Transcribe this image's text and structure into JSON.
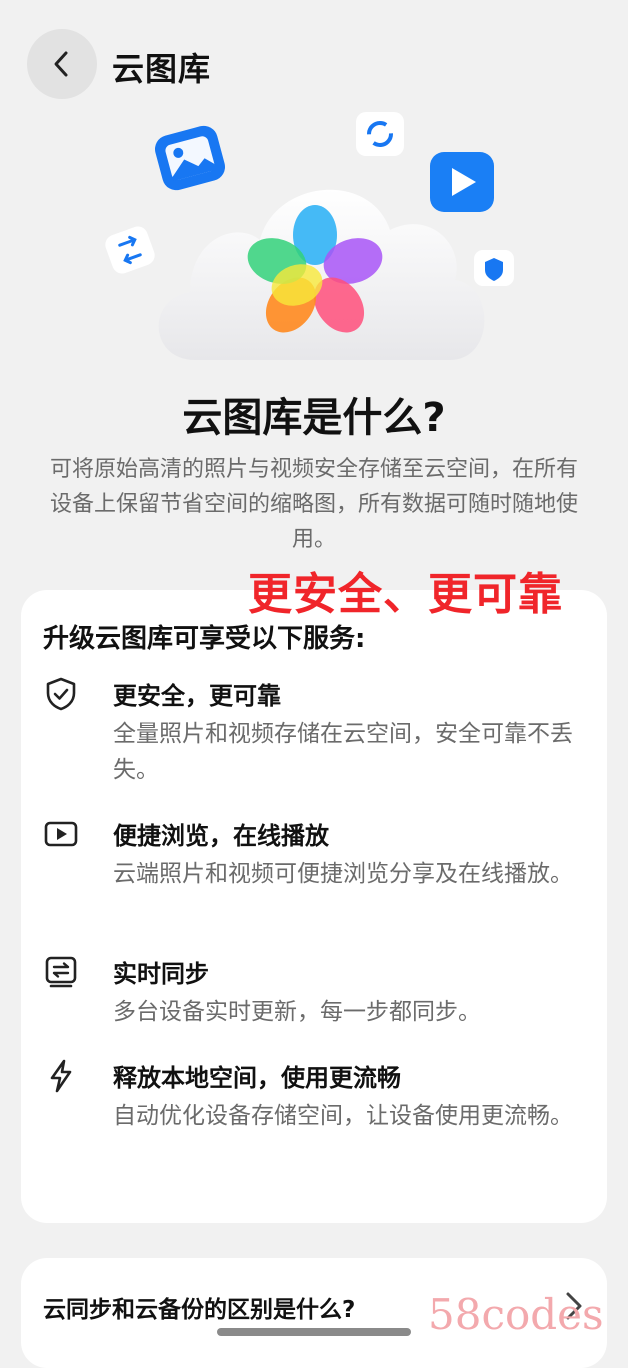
{
  "header": {
    "title": "云图库"
  },
  "hero": {
    "title": "云图库是什么?",
    "description": "可将原始高清的照片与视频安全存储至云空间，在所有设备上保留节省空间的缩略图，所有数据可随时随地使用。"
  },
  "annotation": {
    "text": "更安全、更可靠",
    "color": "#f0252a"
  },
  "services": {
    "heading": "升级云图库可享受以下服务:",
    "items": [
      {
        "icon": "shield-icon",
        "title": "更安全，更可靠",
        "description": "全量照片和视频存储在云空间，安全可靠不丢失。"
      },
      {
        "icon": "play-icon",
        "title": "便捷浏览，在线播放",
        "description": "云端照片和视频可便捷浏览分享及在线播放。"
      },
      {
        "icon": "sync-icon",
        "title": "实时同步",
        "description": "多台设备实时更新，每一步都同步。"
      },
      {
        "icon": "lightning-icon",
        "title": "释放本地空间，使用更流畅",
        "description": "自动优化设备存储空间，让设备使用更流畅。"
      }
    ]
  },
  "faq": {
    "question": "云同步和云备份的区别是什么?"
  },
  "watermark": {
    "text": "58codes"
  }
}
